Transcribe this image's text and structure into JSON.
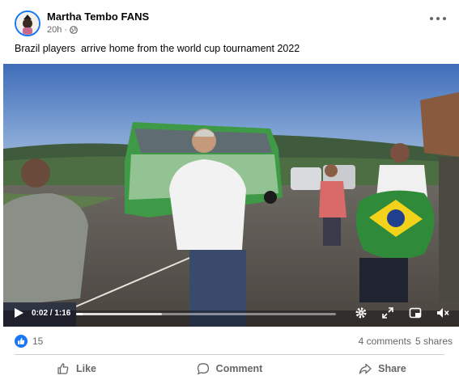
{
  "post": {
    "author": "Martha Tembo FANS",
    "time": "20h",
    "time_separator": "·",
    "privacy_icon": "globe-icon",
    "menu_icon": "more-horizontal-icon",
    "caption": "Brazil players  arrive home from the world cup tournament 2022"
  },
  "video": {
    "current_time": "0:02",
    "duration": "1:16",
    "time_display": "0:02 / 1:16",
    "progress": 0.026,
    "buffered": 0.33,
    "controls": [
      "play-icon",
      "settings-gear-icon",
      "fullscreen-expand-icon",
      "picture-in-picture-icon",
      "volume-muted-icon"
    ]
  },
  "stats": {
    "likes": "15",
    "comments": "4 comments",
    "shares": "5 shares"
  },
  "actions": {
    "like": "Like",
    "comment": "Comment",
    "share": "Share"
  },
  "colors": {
    "accent": "#1877f2",
    "text_secondary": "#65676b",
    "divider": "#ced0d4"
  }
}
